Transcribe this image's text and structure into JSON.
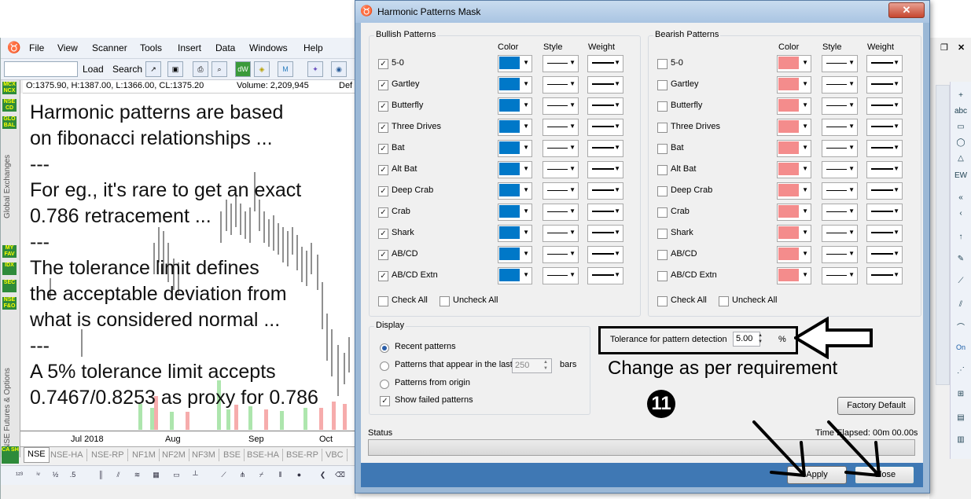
{
  "app": {
    "menu": [
      "File",
      "View",
      "Scanner",
      "Tools",
      "Insert",
      "Data",
      "Windows",
      "Help"
    ],
    "toolbar": {
      "load_label": "Load",
      "search_label": "Search"
    },
    "quote": "O:1375.90, H:1387.00, L:1366.00, CL:1375.20",
    "volume": "Volume: 2,209,945",
    "quote_tail": "Def",
    "left_buttons": [
      "MCX NCX",
      "NSE CD",
      "GLO BAL",
      "MY FAV",
      "IDX",
      "SEC",
      "NSE F&O"
    ],
    "left_labels": {
      "global": "Global Exchanges",
      "nse": "NSE Futures & Options"
    },
    "xaxis": [
      "Jul 2018",
      "Aug",
      "Sep",
      "Oct"
    ],
    "tabs": [
      "NSE",
      "NSE-HA",
      "NSE-RP",
      "NF1M",
      "NF2M",
      "NF3M",
      "BSE",
      "BSE-HA",
      "BSE-RP",
      "VBC"
    ],
    "annotation": "Harmonic patterns are based\non fibonacci relationships ...\n---\nFor eg., it's rare to get an exact\n0.786 retracement ...\n---\nThe tolerance limit defines\nthe acceptable deviation from\nwhat is considered normal ...\n---\nA 5% tolerance limit accepts\n0.7467/0.8253 as proxy for 0.786"
  },
  "dialog": {
    "title": "Harmonic Patterns Mask",
    "bullish": {
      "label": "Bullish Patterns",
      "color_header": "Color",
      "style_header": "Style",
      "weight_header": "Weight",
      "color": "#0078c8",
      "patterns": [
        "5-0",
        "Gartley",
        "Butterfly",
        "Three Drives",
        "Bat",
        "Alt Bat",
        "Deep Crab",
        "Crab",
        "Shark",
        "AB/CD",
        "AB/CD Extn"
      ],
      "checked": true,
      "check_all": "Check All",
      "uncheck_all": "Uncheck All"
    },
    "bearish": {
      "label": "Bearish Patterns",
      "color_header": "Color",
      "style_header": "Style",
      "weight_header": "Weight",
      "color": "#f48c8c",
      "patterns": [
        "5-0",
        "Gartley",
        "Butterfly",
        "Three Drives",
        "Bat",
        "Alt Bat",
        "Deep Crab",
        "Crab",
        "Shark",
        "AB/CD",
        "AB/CD Extn"
      ],
      "checked": false,
      "check_all": "Check All",
      "uncheck_all": "Uncheck All"
    },
    "display": {
      "label": "Display",
      "recent": "Recent patterns",
      "last_prefix": "Patterns that appear in the last",
      "last_value": "250",
      "last_suffix": "bars",
      "origin": "Patterns from origin",
      "show_failed": "Show failed patterns"
    },
    "tolerance": {
      "label": "Tolerance for pattern detection",
      "value": "5.00",
      "unit": "%"
    },
    "hint": "Change as per requirement",
    "step_number": "11",
    "factory_default": "Factory Default",
    "status_label": "Status",
    "elapsed": "Time Elapsed: 00m 00.00s",
    "apply": "Apply",
    "close": "Close"
  }
}
